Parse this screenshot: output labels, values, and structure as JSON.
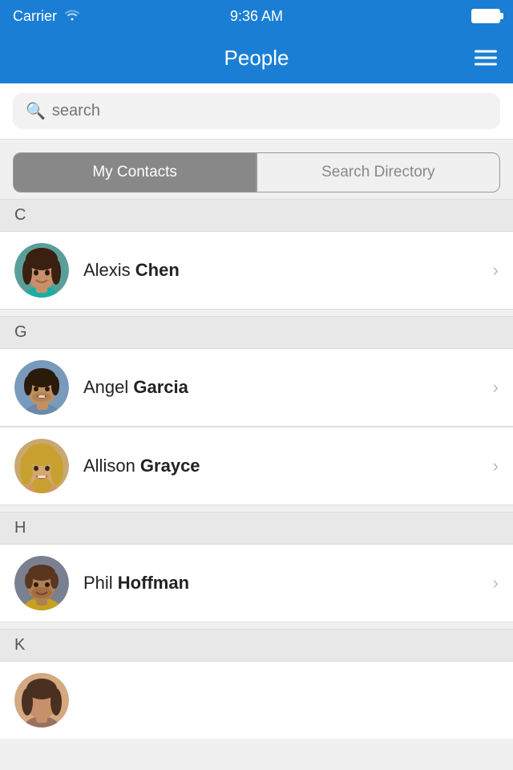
{
  "statusBar": {
    "carrier": "Carrier",
    "time": "9:36 AM"
  },
  "navBar": {
    "title": "People",
    "menuLabel": "menu"
  },
  "search": {
    "placeholder": "search"
  },
  "segments": {
    "active": "My Contacts",
    "inactive": "Search Directory"
  },
  "sections": [
    {
      "letter": "C",
      "contacts": [
        {
          "firstName": "Alexis",
          "lastName": "Chen",
          "id": "alexis-chen"
        }
      ]
    },
    {
      "letter": "G",
      "contacts": [
        {
          "firstName": "Angel",
          "lastName": "Garcia",
          "id": "angel-garcia"
        },
        {
          "firstName": "Allison",
          "lastName": "Grayce",
          "id": "allison-grayce"
        }
      ]
    },
    {
      "letter": "H",
      "contacts": [
        {
          "firstName": "Phil",
          "lastName": "Hoffman",
          "id": "phil-hoffman"
        }
      ]
    },
    {
      "letter": "K",
      "contacts": [
        {
          "firstName": "",
          "lastName": "",
          "id": "k-contact"
        }
      ]
    }
  ],
  "colors": {
    "accent": "#1a7fd4",
    "segmentActive": "#888888"
  }
}
